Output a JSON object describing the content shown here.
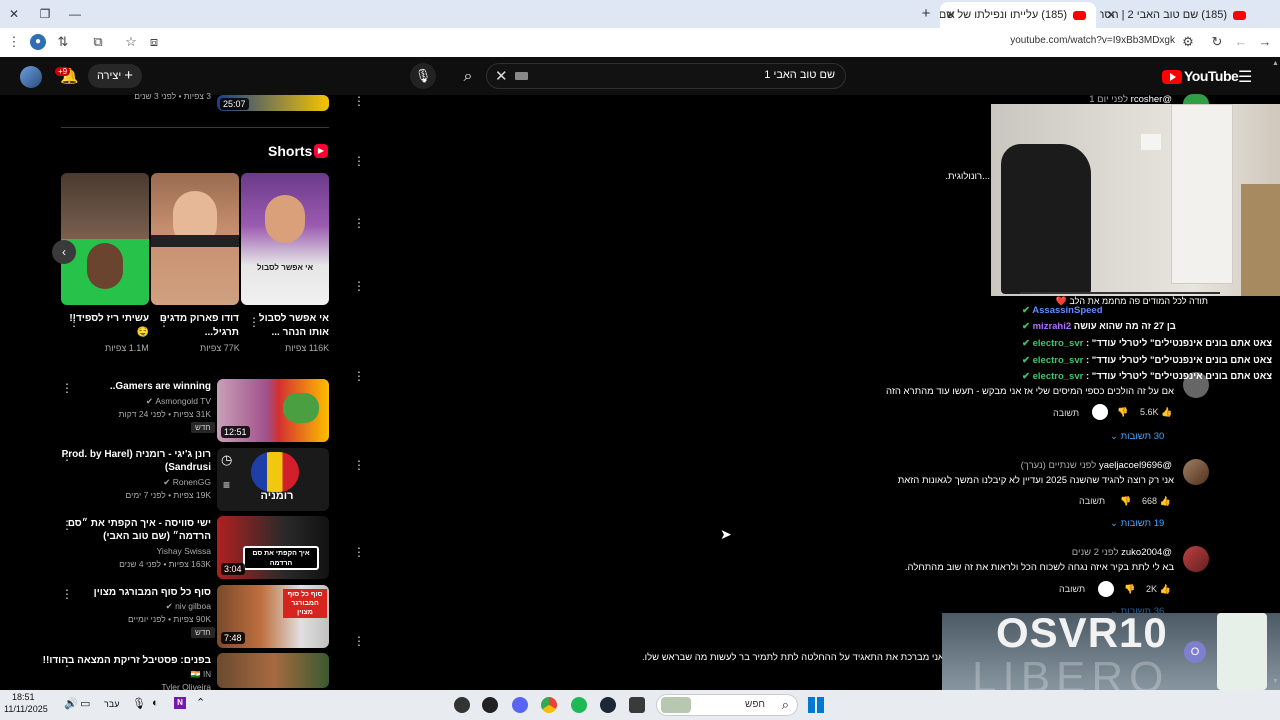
{
  "browser": {
    "tabs": [
      {
        "title": "(185) עלייתו ונפילתו של שם טוב",
        "active": true
      },
      {
        "title": "(185) שם טוב האבי 2 | הסרט ה",
        "active": false
      }
    ],
    "new_tab": "+",
    "url": "youtube.com/watch?v=I9xBb3MDxgk"
  },
  "youtube": {
    "logo_text": "YouTube",
    "search_query": "שם טוב האבי 1",
    "create_label": "יצירה",
    "notifications_badge": "+9"
  },
  "top_video": {
    "duration": "25:07",
    "meta": "3 צפיות • לפני 3 שנים"
  },
  "shorts": {
    "heading": "Shorts",
    "items": [
      {
        "title": "אי אפשר לסבול אותו הנהר ...",
        "views": "116K צפיות"
      },
      {
        "title": "דודו פארוק מדגים תרגיל...",
        "views": "77K צפיות"
      },
      {
        "title": "עשיתי ריז לספיד!! 🤤",
        "views": "1.1M צפיות"
      }
    ]
  },
  "videos": [
    {
      "title": "Gamers are winning..",
      "channel": "Asmongold TV",
      "meta": "31K צפיות • לפני 24 דקות",
      "badge": "חדש",
      "duration": "12:51"
    },
    {
      "title": "רונן ג'יגי - רומניה (Prod. by Harel",
      "title2": "Sandrusi)",
      "channel": "RonenGG",
      "meta": "19K צפיות • לפני 7 ימים",
      "badge": "",
      "duration": ""
    },
    {
      "title": "ישי סוויסה - איך הקפתי את ״סם",
      "title2": "הרדמה״ (שם טוב האבי)",
      "channel": "Yishay Swissa",
      "meta": "163K צפיות • לפני 4 שנים",
      "badge": "",
      "duration": "3:04"
    },
    {
      "title": "סוף כל סוף המבורגר מצוין",
      "channel": "niv gilboa",
      "meta": "90K צפיות • לפני יומיים",
      "badge": "חדש",
      "duration": "7:48"
    },
    {
      "title": "בפנים: פסטיבל זריקת המצאה בהודו!!",
      "channel": "Tyler Oliveira",
      "meta": "",
      "badge": "",
      "duration": ""
    }
  ],
  "thumb_texts": {
    "romania": "רומניה",
    "sam": "איך הקפתי את סם הרדמה",
    "burger": "סוף כל סוף המבורגר מצוין",
    "shorts1": "אי אפשר לסבול"
  },
  "comments": [
    {
      "user": "@rcosher",
      "time": "לפני יום 1",
      "text": "...רונולוגית.",
      "likes": "",
      "replies": ""
    },
    {
      "user": "",
      "time": "",
      "text": "אם על זה הולכים כספי המיסים שלי אז אני מבקש - תעשו עוד מהתרא הזה",
      "likes": "5.6K",
      "replies": "30 תשובות"
    },
    {
      "user": "@yaeljacoel9696",
      "time": "לפני שנתיים (נערך)",
      "text": "אני רק רוצה להגיד שהשנה 2025 ועדיין לא קיבלנו המשך לגאונות הזאת",
      "likes": "668",
      "replies": "19 תשובות"
    },
    {
      "user": "@zuko2004",
      "time": "לפני 2 שנים",
      "text": "בא לי לתת בקיר איזה נגחה לשכוח הכל ולראות את זה שוב מהתחלה.",
      "likes": "2K",
      "replies": "36 תשובות"
    },
    {
      "user": "",
      "time": "",
      "text": "אני מברכת את התאגיד על ההחלטה לתת לתמיר בר לעשות מה שבראש שלו.",
      "likes": "",
      "replies": ""
    }
  ],
  "reply_label": "תשובה",
  "stream_chat": [
    {
      "user": "",
      "text": "תודה לכל המודים פה מחממ את הלב ❤️",
      "color": "#ffffff"
    },
    {
      "user": "AssassinSpeed",
      "text": "",
      "color": "#5b8cff"
    },
    {
      "user": "mizrahi2",
      "text": "בן 27 זה מה שהוא עושה",
      "color": "#b06cff"
    },
    {
      "user": "electro_svr",
      "text": "\"צאט אתם בונים אינפנטילים\" ליטרלי עודד",
      "color": "#3ec46d"
    },
    {
      "user": "electro_svr",
      "text": "\"צאט אתם בונים אינפנטילים\" ליטרלי עודד",
      "color": "#3ec46d"
    },
    {
      "user": "electro_svr",
      "text": "\"צאט אתם בונים אינפנטילים\" ליטרלי עודד",
      "color": "#3ec46d"
    }
  ],
  "overlay": {
    "brand": "OSVR10",
    "product": "LIBERO"
  },
  "taskbar": {
    "time": "18:51",
    "date": "11/11/2025",
    "lang": "עבר",
    "search": "חפש"
  }
}
